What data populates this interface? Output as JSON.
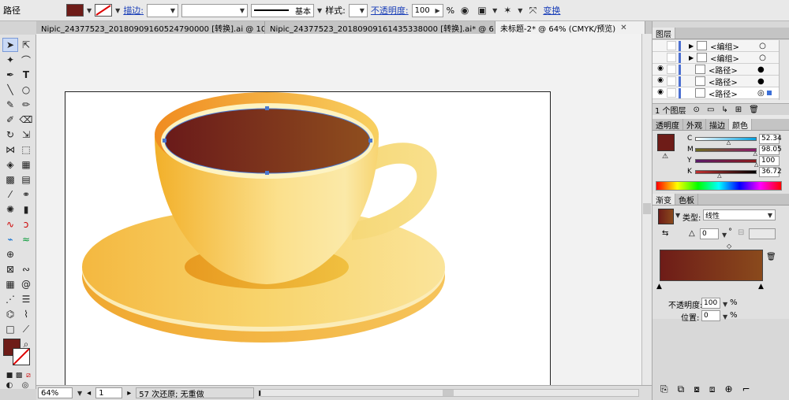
{
  "control_bar": {
    "object_type": "路径",
    "fill_color": "#6e1c18",
    "stroke_label": "描边:",
    "stroke_style_label": "基本",
    "style_label": "样式:",
    "opacity_label": "不透明度:",
    "opacity_value": "100",
    "opacity_unit": "%",
    "transform_label": "变换"
  },
  "tabs": [
    {
      "label": "Nipic_24377523_20180909160524790000 [转换].ai @ 10...",
      "active": false
    },
    {
      "label": "Nipic_24377523_20180909161435338000 [转换].ai* @ 6...",
      "active": false
    },
    {
      "label": "未标题-2* @ 64% (CMYK/预览)",
      "active": true
    }
  ],
  "status": {
    "zoom": "64%",
    "page": "1",
    "history": "57 次还原; 无重做"
  },
  "layers_panel": {
    "title": "图层",
    "rows": [
      {
        "name": "<编组>",
        "thumb": "group-icon"
      },
      {
        "name": "<编组>",
        "thumb": "group-icon"
      },
      {
        "name": "<路径>",
        "thumb": "path-icon"
      },
      {
        "name": "<路径>",
        "thumb": "path-icon"
      },
      {
        "name": "<路径>",
        "thumb": "path-icon"
      }
    ],
    "count_label": "1 个图层"
  },
  "color_panel": {
    "tabs": [
      "透明度",
      "外观",
      "描边",
      "颜色"
    ],
    "active_tab": "颜色",
    "swatch": "#6e1c18",
    "channels": [
      {
        "key": "C",
        "value": "52.34",
        "pos": 0.5234
      },
      {
        "key": "M",
        "value": "98.05",
        "pos": 0.9805
      },
      {
        "key": "Y",
        "value": "100",
        "pos": 1.0
      },
      {
        "key": "K",
        "value": "36.72",
        "pos": 0.3672
      }
    ]
  },
  "gradient_panel": {
    "tabs": [
      "渐变",
      "色板"
    ],
    "active_tab": "渐变",
    "type_label": "类型:",
    "type_value": "线性",
    "angle_value": "0",
    "opacity_label": "不透明度:",
    "opacity_value": "100",
    "position_label": "位置:",
    "position_value": "0",
    "unit": "%",
    "start_color": "#6e1c18",
    "end_color": "#8a4a1c"
  }
}
